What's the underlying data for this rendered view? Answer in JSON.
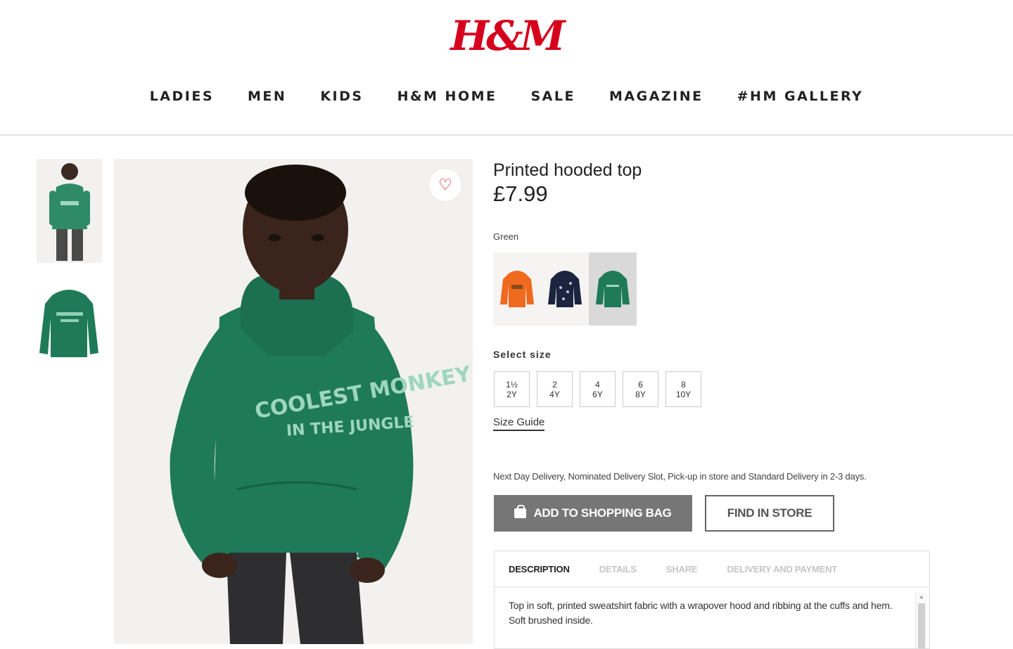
{
  "header": {
    "logo": "H&M",
    "nav": [
      "LADIES",
      "MEN",
      "KIDS",
      "H&M HOME",
      "SALE",
      "MAGAZINE",
      "#HM GALLERY"
    ]
  },
  "gallery": {
    "thumbnails": [
      "model-front-thumbnail",
      "hoodie-flat-thumbnail"
    ],
    "main_image": "child-model-green-hoodie-photo",
    "hoodie_print": [
      "COOLEST MONKEY",
      "IN THE JUNGLE"
    ],
    "favourite_icon": "heart-icon"
  },
  "product": {
    "title": "Printed hooded top",
    "price": "£7.99",
    "color_label": "Green",
    "swatches": [
      {
        "name": "orange",
        "color": "#ef6a1f"
      },
      {
        "name": "navy-print",
        "color": "#1b2540"
      },
      {
        "name": "green",
        "color": "#1f7a59",
        "selected": true
      }
    ],
    "size_label": "Select size",
    "sizes": [
      {
        "top": "1½",
        "bottom": "2Y"
      },
      {
        "top": "2",
        "bottom": "4Y"
      },
      {
        "top": "4",
        "bottom": "6Y"
      },
      {
        "top": "6",
        "bottom": "8Y"
      },
      {
        "top": "8",
        "bottom": "10Y"
      }
    ],
    "size_guide": "Size Guide",
    "delivery": "Next Day Delivery, Nominated Delivery Slot, Pick-up in store and Standard Delivery in 2-3 days.",
    "add_to_bag": "ADD TO SHOPPING BAG",
    "find_in_store": "FIND IN STORE"
  },
  "info_tabs": {
    "tabs": [
      "DESCRIPTION",
      "DETAILS",
      "SHARE",
      "DELIVERY AND PAYMENT"
    ],
    "active": "DESCRIPTION",
    "description": "Top in soft, printed sweatshirt fabric with a wrapover hood and ribbing at the cuffs and hem. Soft brushed inside."
  },
  "colors": {
    "brand_red": "#d6001c",
    "hoodie_green": "#1f7a59",
    "button_gray": "#767676"
  }
}
